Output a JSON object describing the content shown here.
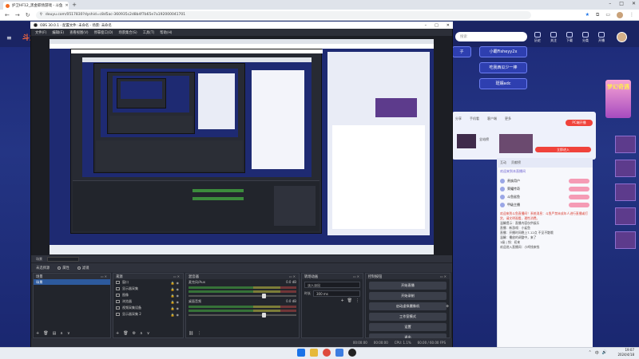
{
  "browser": {
    "tab_title": "护卫HF12_黑金职场游戏 - 斗鱼",
    "url": "douyu.com/0517830?dyshid=c8d5ac-360935c2d8b4f7b65e7a192000041701",
    "new_tab": "+",
    "controls": {
      "min": "–",
      "max": "□",
      "close": "✕"
    }
  },
  "site": {
    "logo": "斗鱼",
    "search_placeholder": "搜索",
    "header_icons": [
      "历史",
      "关注",
      "下载",
      "分类",
      "开播"
    ],
    "channels": [
      "小霸Fisheyy2x",
      "吃我西瓜少一棒",
      "斑斓adc"
    ],
    "channel_left": "子",
    "banner_text": "梦幻奇遇",
    "pc_live": "PC端开播",
    "room_actions": [
      "分享",
      "手机看",
      "客户端",
      "更多"
    ],
    "enter_room": "立即进入",
    "side_label": "全站榜",
    "chat_tabs": [
      "互动",
      "贡献榜"
    ],
    "chat_header": "欢迎来到本直播间",
    "gift_rows": [
      "贵族用户",
      "荣耀传奇",
      "斗鱼鲨鱼",
      "甲级主播"
    ],
    "chat_lines": [
      "欢迎来到斗鱼直播间！系统消息：斗鱼严禁未成年人进行直播或打赏，请文明观看，理性消费。",
      "温馨提示：直播内容仅供娱乐",
      "直播：新游戏：小鲨鱼",
      "直播：开播时间晚上7-12点 不见不散哦",
      "温馨：播放的调整中，来了",
      "1级 | 钱：初来",
      "欢迎进入直播间：小鸡钱来钱"
    ]
  },
  "obs": {
    "title": "OBS 30.0.1 - 配置文件: 未命名 - 场景: 未命名",
    "menu": [
      "文件(F)",
      "编辑(E)",
      "查看视图(V)",
      "停靠窗口(D)",
      "场景集合(S)",
      "工具(T)",
      "帮助(H)"
    ],
    "scene_bar_label": "场景",
    "scene_select": "未选择场景",
    "source_label": "未选择源",
    "properties_btn": "属性",
    "filters_btn": "滤镜",
    "docks": {
      "scenes": "场景",
      "sources": "来源",
      "mixer": "混音器",
      "transitions": "转场动画",
      "controls": "控制按钮"
    },
    "scene_items": [
      "场景"
    ],
    "sources": [
      "窗口",
      "显示器采集",
      "图像",
      "浏览器",
      "视频采集设备",
      "显示器采集 2"
    ],
    "mixer_channels": [
      {
        "name": "桌面音频",
        "db": "0.0 dB"
      },
      {
        "name": "麦克风/Aux",
        "db": "0.0 dB"
      }
    ],
    "transition": "淡入淡出",
    "duration_label": "时长",
    "duration_value": "300 ms",
    "control_buttons": [
      "开始直播",
      "开始录制",
      "启动虚拟摄像机",
      "工作室模式",
      "设置",
      "退出"
    ],
    "status": {
      "rec": "00:00:00",
      "live": "00:00:00",
      "cpu": "CPU: 1.1%",
      "fps": "60.00 / 60.00 FPS"
    }
  },
  "taskbar": {
    "time": "19:07",
    "date": "2024/4/18",
    "tray": [
      "⌃",
      "中",
      "🔊"
    ]
  },
  "colors": {
    "site_bg": "#1d2a78",
    "obs_bg": "#272a33",
    "accent_red": "#f0433b",
    "selected_blue": "#2d5a9d"
  }
}
